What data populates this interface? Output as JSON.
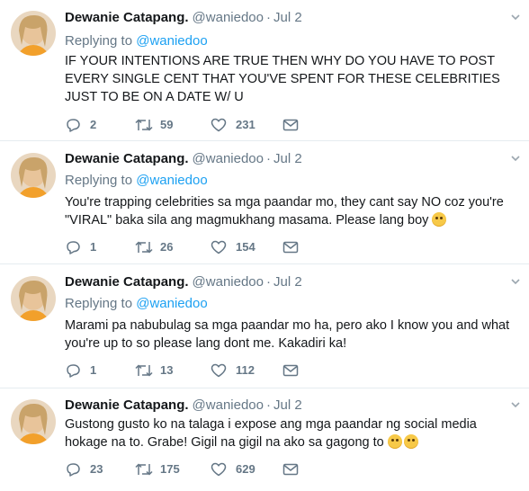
{
  "tweets": [
    {
      "name": "Dewanie Catapang.",
      "handle": "@waniedoo",
      "dot": "·",
      "date": "Jul 2",
      "replying_label": "Replying to",
      "replying_to": "@waniedoo",
      "text": "IF YOUR INTENTIONS ARE TRUE THEN WHY DO YOU HAVE TO POST EVERY SINGLE CENT THAT YOU'VE SPENT FOR THESE CELEBRITIES JUST TO BE ON A DATE W/ U",
      "replies": "2",
      "retweets": "59",
      "likes": "231"
    },
    {
      "name": "Dewanie Catapang.",
      "handle": "@waniedoo",
      "dot": "·",
      "date": "Jul 2",
      "replying_label": "Replying to",
      "replying_to": "@waniedoo",
      "text": "You're trapping celebrities sa mga paandar mo, they cant say NO coz you're \"VIRAL\" baka sila ang magmukhang masama. Please lang boy",
      "emoji": "face-with-rolling-eyes",
      "replies": "1",
      "retweets": "26",
      "likes": "154"
    },
    {
      "name": "Dewanie Catapang.",
      "handle": "@waniedoo",
      "dot": "·",
      "date": "Jul 2",
      "replying_label": "Replying to",
      "replying_to": "@waniedoo",
      "text": "Marami pa nabubulag sa mga paandar mo ha, pero ako I know you and what you're up to so please lang dont me. Kakadiri ka!",
      "replies": "1",
      "retweets": "13",
      "likes": "112"
    },
    {
      "name": "Dewanie Catapang.",
      "handle": "@waniedoo",
      "dot": "·",
      "date": "Jul 2",
      "text": "Gustong gusto ko na talaga i expose ang mga paandar ng social media hokage na to. Grabe! Gigil na gigil na ako sa gagong to",
      "emoji": "upside-down-face",
      "replies": "23",
      "retweets": "175",
      "likes": "629"
    }
  ],
  "icons": {
    "reply": "reply-icon",
    "retweet": "retweet-icon",
    "like": "heart-icon",
    "message": "envelope-icon",
    "more": "chevron-down-icon"
  },
  "colors": {
    "name": "#14171a",
    "secondary": "#657786",
    "link": "#1da1f2",
    "divider": "#e6ecf0"
  }
}
